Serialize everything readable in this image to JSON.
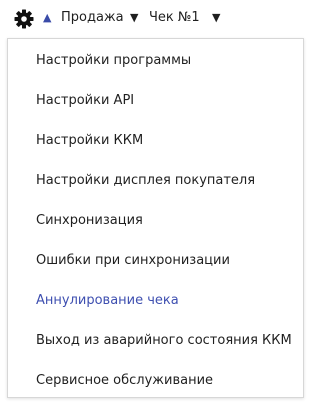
{
  "toolbar": {
    "settings_icon": "gear-icon",
    "sort_icon": "triangle-up-icon",
    "sort_color": "#3a4ba8",
    "mode_label": "Продажа",
    "mode_dropdown_icon": "triangle-down-icon",
    "receipt_label": "Чек №1",
    "receipt_dropdown_icon": "triangle-down-icon"
  },
  "menu": {
    "active_color": "#3e4fb0",
    "items": [
      {
        "label": "Настройки программы"
      },
      {
        "label": "Настройки API"
      },
      {
        "label": "Настройки ККМ"
      },
      {
        "label": "Настройки дисплея покупателя"
      },
      {
        "label": "Синхронизация"
      },
      {
        "label": "Ошибки при синхронизации"
      },
      {
        "label": "Аннулирование чека",
        "highlighted": true
      },
      {
        "label": "Выход из аварийного состояния ККМ"
      },
      {
        "label": "Сервисное обслуживание"
      }
    ]
  }
}
